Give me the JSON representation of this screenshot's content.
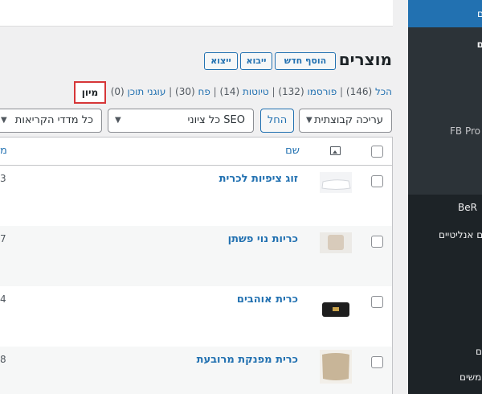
{
  "sidebar": {
    "active_label": "ם",
    "items": [
      {
        "label": "ם"
      },
      {
        "label": "FB Pro"
      },
      {
        "label": "BeR"
      },
      {
        "label": "ם אנליטיים"
      },
      {
        "label": "ים"
      },
      {
        "label": "משים"
      }
    ]
  },
  "header": {
    "title": "מוצרים",
    "add_new": "הוסף חדש",
    "import": "ייבוא",
    "export": "ייצוא"
  },
  "views": {
    "all": "הכל",
    "all_count": "(146)",
    "published": "פורסמו",
    "published_count": "(132)",
    "drafts": "טיוטות",
    "drafts_count": "(14)",
    "trash": "פח",
    "trash_count": "(30)",
    "corner": "עוגני תוכן",
    "corner_count": "(0)",
    "sort": "מיון"
  },
  "filters": {
    "bulk": "עריכה קבוצתית",
    "apply": "החל",
    "seo": "כל ציוני SEO",
    "readability": "כל מדדי הקריאות"
  },
  "table": {
    "col_name": "שם",
    "col_cut": "מ",
    "rows": [
      {
        "name": "זוג ציפיות לכרית",
        "cut": "3"
      },
      {
        "name": "כריות נוי פשתן",
        "cut": "7"
      },
      {
        "name": "כרית אוהבים",
        "cut": "4"
      },
      {
        "name": "כרית מפנקת מרובעת",
        "cut": "8"
      }
    ]
  },
  "colors": {
    "accent": "#2271b1",
    "sidebar": "#1d2327",
    "highlight": "#d63638"
  }
}
